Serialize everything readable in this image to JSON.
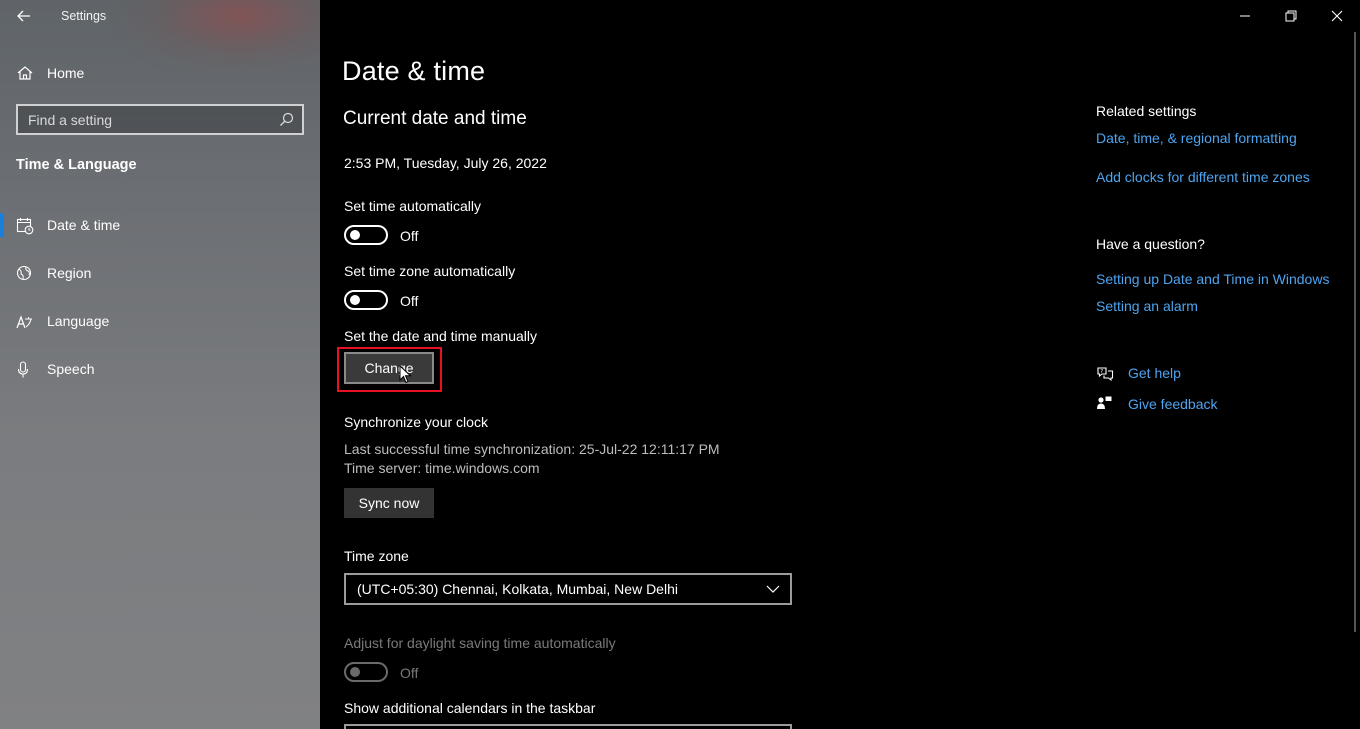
{
  "window": {
    "app_title": "Settings"
  },
  "sidebar": {
    "home_label": "Home",
    "search_placeholder": "Find a setting",
    "section_title": "Time & Language",
    "items": [
      {
        "label": "Date & time",
        "icon": "calendar-clock-icon",
        "selected": true
      },
      {
        "label": "Region",
        "icon": "globe-icon",
        "selected": false
      },
      {
        "label": "Language",
        "icon": "language-icon",
        "selected": false
      },
      {
        "label": "Speech",
        "icon": "microphone-icon",
        "selected": false
      }
    ]
  },
  "main": {
    "page_title": "Date & time",
    "current_heading": "Current date and time",
    "current_datetime": "2:53 PM, Tuesday, July 26, 2022",
    "set_time_auto": {
      "label": "Set time automatically",
      "state": "Off"
    },
    "set_tz_auto": {
      "label": "Set time zone automatically",
      "state": "Off"
    },
    "manual": {
      "label": "Set the date and time manually",
      "button": "Change"
    },
    "sync": {
      "heading": "Synchronize your clock",
      "last_sync": "Last successful time synchronization: 25-Jul-22 12:11:17 PM",
      "server": "Time server: time.windows.com",
      "button": "Sync now"
    },
    "timezone": {
      "label": "Time zone",
      "value": "(UTC+05:30) Chennai, Kolkata, Mumbai, New Delhi"
    },
    "dst": {
      "label": "Adjust for daylight saving time automatically",
      "state": "Off"
    },
    "calendars": {
      "label": "Show additional calendars in the taskbar"
    }
  },
  "related": {
    "heading": "Related settings",
    "links": [
      "Date, time, & regional formatting",
      "Add clocks for different time zones"
    ],
    "question_heading": "Have a question?",
    "question_links": [
      "Setting up Date and Time in Windows",
      "Setting an alarm"
    ],
    "help": "Get help",
    "feedback": "Give feedback"
  },
  "colors": {
    "accent": "#1a7fd8",
    "link": "#4ea4ef",
    "highlight": "#e81123"
  }
}
